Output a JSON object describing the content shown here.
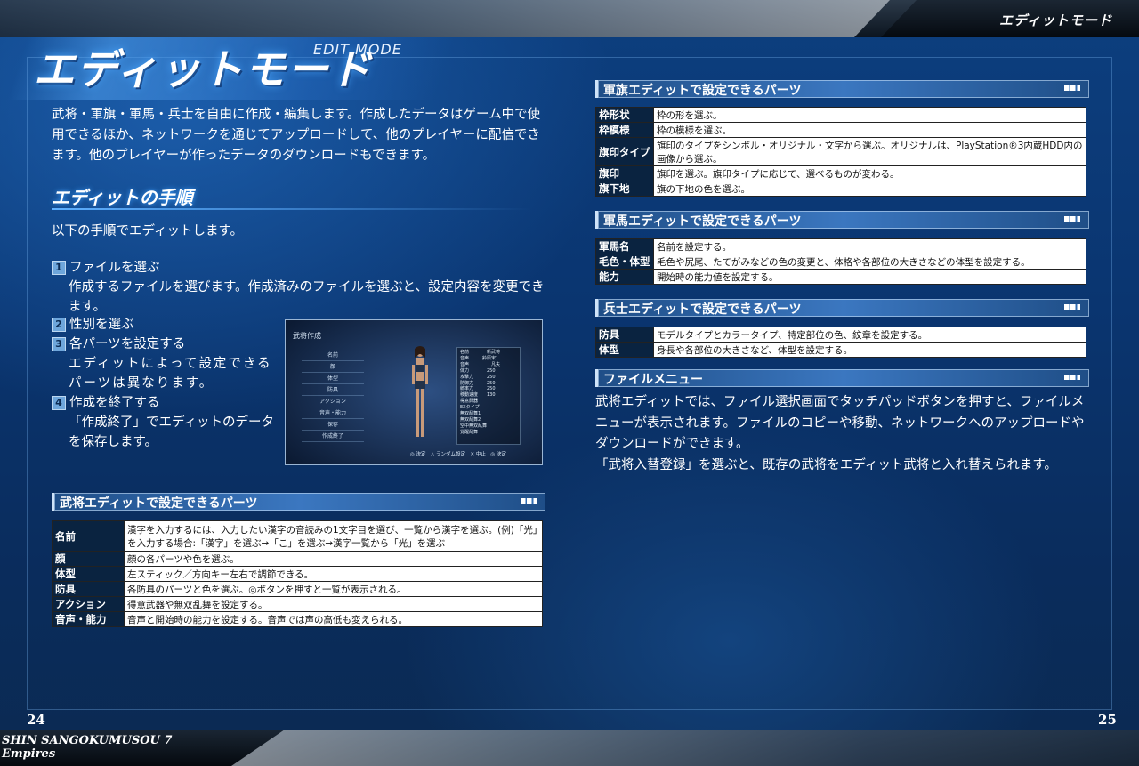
{
  "header": {
    "label": "エディットモード"
  },
  "title": {
    "main": "エディットモード",
    "sub": "EDIT MODE"
  },
  "lead": "武将・軍旗・軍馬・兵士を自由に作成・編集します。作成したデータはゲーム中で使用できるほか、ネットワークを通じてアップロードして、他のプレイヤーに配信できます。他のプレイヤーが作ったデータのダウンロードもできます。",
  "procedure": {
    "heading": "エディットの手順",
    "intro": "以下の手順でエディットします。",
    "steps": [
      {
        "num": "1",
        "title": "ファイルを選ぶ",
        "body": "作成するファイルを選びます。作成済みのファイルを選ぶと、設定内容を変更できます。"
      },
      {
        "num": "2",
        "title": "性別を選ぶ",
        "body": ""
      },
      {
        "num": "3",
        "title": "各パーツを設定する",
        "body": "エディットによって設定できるパーツは異なります。"
      },
      {
        "num": "4",
        "title": "作成を終了する",
        "body": "「作成終了」でエディットのデータを保存します。"
      }
    ]
  },
  "screenshot": {
    "title": "武将作成",
    "menu": [
      "名前",
      "顔",
      "体型",
      "防具",
      "アクション",
      "音声・能力",
      "保存",
      "作成終了"
    ],
    "stats": [
      "名前　　　　新武将",
      "音声　　　鈴原宋1",
      "音声　　　　　凡夫",
      "体力　　　　250",
      "攻撃力　　　250",
      "防御力　　　250",
      "統率力　　　250",
      "移動速度　　130",
      "得意武器　　　　　",
      "EXタイプ　　　　",
      "無双乱舞1　　",
      "無双乱舞2　　",
      "空中無双乱舞",
      "覚醒乱舞"
    ],
    "footer": "◎ 決定　△ ランダム設定　✕ 中止　◎ 決定"
  },
  "general_table": {
    "heading": "武将エディットで設定できるパーツ",
    "rows": [
      {
        "k": "名前",
        "v": "漢字を入力するには、入力したい漢字の音読みの1文字目を選び、一覧から漢字を選ぶ。(例)「光」を入力する場合:「漢字」を選ぶ→「こ」を選ぶ→漢字一覧から「光」を選ぶ"
      },
      {
        "k": "顔",
        "v": "顔の各パーツや色を選ぶ。"
      },
      {
        "k": "体型",
        "v": "左スティック／方向キー左右で調節できる。"
      },
      {
        "k": "防具",
        "v": "各防具のパーツと色を選ぶ。◎ボタンを押すと一覧が表示される。"
      },
      {
        "k": "アクション",
        "v": "得意武器や無双乱舞を設定する。"
      },
      {
        "k": "音声・能力",
        "v": "音声と開始時の能力を設定する。音声では声の高低も変えられる。"
      }
    ]
  },
  "flag_table": {
    "heading": "軍旗エディットで設定できるパーツ",
    "rows": [
      {
        "k": "枠形状",
        "v": "枠の形を選ぶ。"
      },
      {
        "k": "枠模様",
        "v": "枠の模様を選ぶ。"
      },
      {
        "k": "旗印タイプ",
        "v": "旗印のタイプをシンボル・オリジナル・文字から選ぶ。オリジナルは、PlayStation®3内蔵HDD内の画像から選ぶ。"
      },
      {
        "k": "旗印",
        "v": "旗印を選ぶ。旗印タイプに応じて、選べるものが変わる。"
      },
      {
        "k": "旗下地",
        "v": "旗の下地の色を選ぶ。"
      }
    ]
  },
  "horse_table": {
    "heading": "軍馬エディットで設定できるパーツ",
    "rows": [
      {
        "k": "軍馬名",
        "v": "名前を設定する。"
      },
      {
        "k": "毛色・体型",
        "v": "毛色や尻尾、たてがみなどの色の変更と、体格や各部位の大きさなどの体型を設定する。"
      },
      {
        "k": "能力",
        "v": "開始時の能力値を設定する。"
      }
    ]
  },
  "soldier_table": {
    "heading": "兵士エディットで設定できるパーツ",
    "rows": [
      {
        "k": "防具",
        "v": "モデルタイプとカラータイプ、特定部位の色、紋章を設定する。"
      },
      {
        "k": "体型",
        "v": "身長や各部位の大きさなど、体型を設定する。"
      }
    ]
  },
  "file_menu": {
    "heading": "ファイルメニュー",
    "body1": "武将エディットでは、ファイル選択画面でタッチパッドボタンを押すと、ファイルメニューが表示されます。ファイルのコピーや移動、ネットワークへのアップロードやダウンロードができます。",
    "body2": "「武将入替登録」を選ぶと、既存の武将をエディット武将と入れ替えられます。"
  },
  "footer": {
    "title": "SHIN SANGOKUMUSOU 7 Empires",
    "page_left": "24",
    "page_right": "25"
  }
}
